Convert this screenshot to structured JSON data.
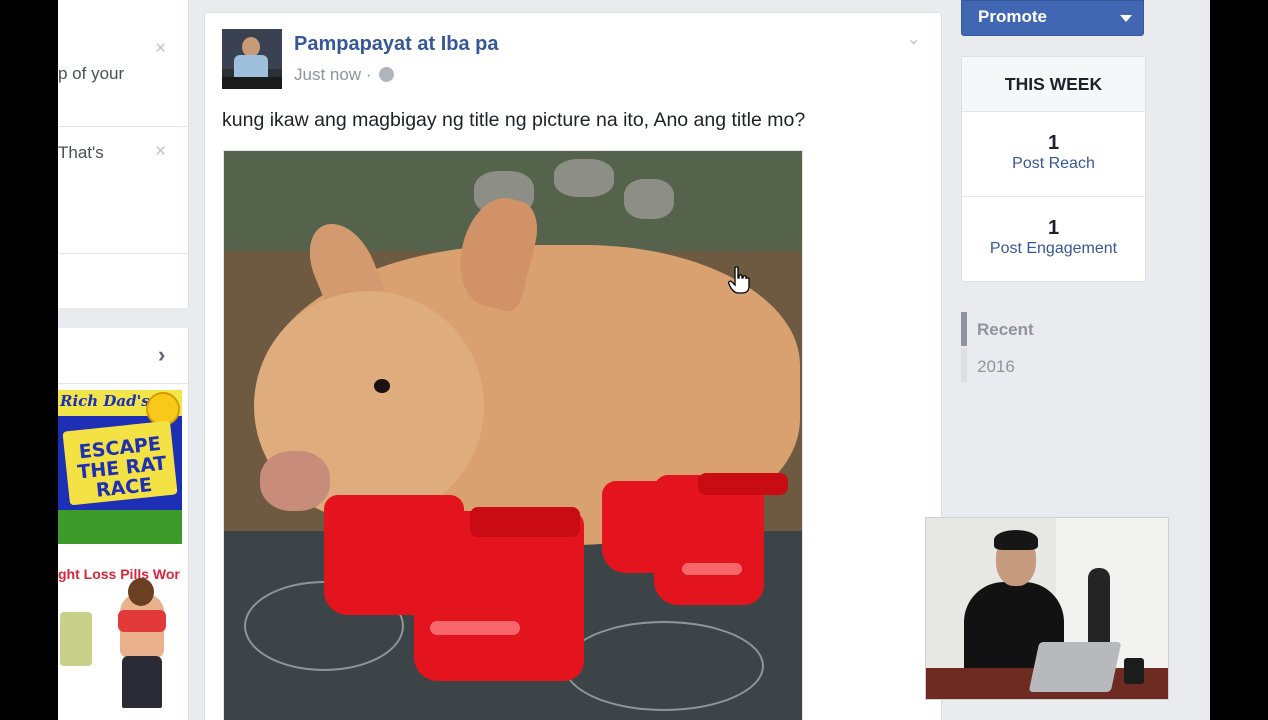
{
  "left_column": {
    "notifications": [
      {
        "text": "p of your"
      },
      {
        "text": "That's"
      }
    ],
    "ads": [
      {
        "brand": "Rich Dad's",
        "title": "ESCAPE THE RAT RACE"
      },
      {
        "text": "ght Loss Pills Wor"
      }
    ]
  },
  "post": {
    "page_name": "Pampapayat at Iba pa",
    "timestamp": "Just now",
    "separator": "·",
    "text": "kung ikaw ang magbigay ng title ng picture na ito, Ano ang title mo?"
  },
  "sidebar": {
    "promote_label": "Promote",
    "week_title": "THIS WEEK",
    "stats": [
      {
        "value": "1",
        "label": "Post Reach"
      },
      {
        "value": "1",
        "label": "Post Engagement"
      }
    ],
    "timeline": [
      {
        "label": "Recent"
      },
      {
        "label": "2016"
      }
    ]
  },
  "colors": {
    "brand": "#4267b2",
    "link": "#365899",
    "background": "#e9ebee"
  },
  "icons": {
    "close": "close-icon",
    "chevron": "chevron-right-icon",
    "globe": "globe-icon",
    "caret": "chevron-down-icon",
    "cursor": "hand-cursor-icon"
  }
}
